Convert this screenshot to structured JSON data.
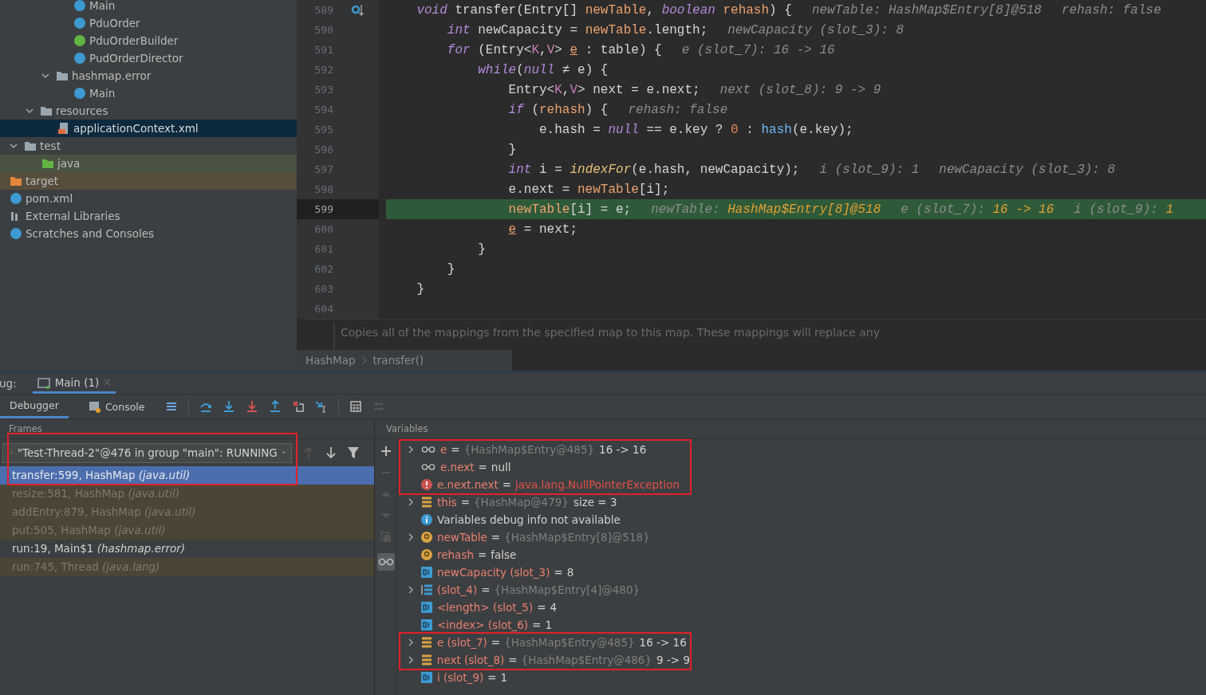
{
  "project_tree": [
    {
      "children": [
        {
          "children": [
            {
              "children": [
                {
                  "children": [
                    {
                      "label": "Main",
                      "kind": "class-run",
                      "selected": false
                    },
                    {
                      "label": "PduOrder",
                      "kind": "class",
                      "selected": false
                    },
                    {
                      "label": "PduOrderBuilder",
                      "kind": "interface",
                      "selected": false
                    },
                    {
                      "label": "PudOrderDirector",
                      "kind": "class",
                      "selected": false
                    }
                  ]
                },
                {
                  "label": "hashmap.error",
                  "kind": "package",
                  "expanded": true,
                  "selected": false,
                  "children": [
                    {
                      "label": "Main",
                      "kind": "class-run",
                      "selected": false
                    }
                  ]
                }
              ]
            },
            {
              "label": "resources",
              "kind": "resources",
              "expanded": true,
              "selected": false,
              "children": [
                {
                  "label": "applicationContext.xml",
                  "kind": "xml",
                  "selected": true
                }
              ]
            }
          ]
        },
        {
          "label": "test",
          "kind": "folder",
          "expanded": true,
          "selected": false,
          "children": [
            {
              "label": "java",
              "kind": "test-folder",
              "selected": false,
              "color": "#4a5243"
            }
          ]
        }
      ]
    },
    {
      "label": "target",
      "kind": "excluded-folder",
      "selected": false,
      "color": "#564d3c"
    },
    {
      "label": "pom.xml",
      "kind": "maven",
      "selected": false
    },
    {
      "label": "External Libraries",
      "kind": "library",
      "selected": false
    },
    {
      "label": "Scratches and Consoles",
      "kind": "scratch",
      "selected": false
    }
  ],
  "editor": {
    "lines": [
      {
        "number": "589",
        "current": false,
        "marker": true,
        "tokens": [
          {
            "kind": "kw",
            "text": "void"
          },
          {
            "kind": "plain",
            "text": " transfer(Entry[] "
          },
          {
            "kind": "param",
            "text": "newTable"
          },
          {
            "kind": "plain",
            "text": ", "
          },
          {
            "kind": "kw",
            "text": "boolean"
          },
          {
            "kind": "param",
            "text": " rehash"
          },
          {
            "kind": "plain",
            "text": ") {"
          }
        ],
        "hints": [
          {
            "label": "newTable:",
            "value": "HashMap$Entry[8]@518"
          },
          {
            "label": "rehash:",
            "value": "false"
          }
        ],
        "children": [
          {
            "number": "590",
            "current": false,
            "marker": false,
            "tokens": [
              {
                "kind": "kw",
                "text": "int"
              },
              {
                "kind": "plain",
                "text": " newCapacity = "
              },
              {
                "kind": "param",
                "text": "newTable"
              },
              {
                "kind": "plain",
                "text": ".length;"
              }
            ],
            "hints": [
              {
                "label": "newCapacity (slot_3):",
                "value": "8"
              }
            ]
          },
          {
            "number": "591",
            "current": false,
            "marker": false,
            "tokens": [
              {
                "kind": "kw",
                "text": "for"
              },
              {
                "kind": "plain",
                "text": " (Entry<"
              },
              {
                "kind": "type",
                "text": "K"
              },
              {
                "kind": "plain",
                "text": ","
              },
              {
                "kind": "type",
                "text": "V"
              },
              {
                "kind": "plain",
                "text": "> "
              },
              {
                "kind": "var",
                "text": "e"
              },
              {
                "kind": "plain",
                "text": " : table) {"
              }
            ],
            "hints": [
              {
                "label": "e (slot_7):",
                "value": "16 -> 16"
              }
            ],
            "children": [
              {
                "number": "592",
                "current": false,
                "marker": false,
                "tokens": [
                  {
                    "kind": "kw",
                    "text": "while"
                  },
                  {
                    "kind": "plain",
                    "text": "("
                  },
                  {
                    "kind": "kw",
                    "text": "null"
                  },
                  {
                    "kind": "plain",
                    "text": " ≠ e) {"
                  }
                ],
                "children": [
                  {
                    "number": "593",
                    "current": false,
                    "marker": false,
                    "tokens": [
                      {
                        "kind": "plain",
                        "text": "Entry<"
                      },
                      {
                        "kind": "type",
                        "text": "K"
                      },
                      {
                        "kind": "plain",
                        "text": ","
                      },
                      {
                        "kind": "type",
                        "text": "V"
                      },
                      {
                        "kind": "plain",
                        "text": "> next = e.next;"
                      }
                    ],
                    "hints": [
                      {
                        "label": "next (slot_8):",
                        "value": "9 -> 9"
                      }
                    ]
                  },
                  {
                    "number": "594",
                    "current": false,
                    "marker": false,
                    "tokens": [
                      {
                        "kind": "kw",
                        "text": "if"
                      },
                      {
                        "kind": "plain",
                        "text": " ("
                      },
                      {
                        "kind": "param",
                        "text": "rehash"
                      },
                      {
                        "kind": "plain",
                        "text": ") {"
                      }
                    ],
                    "hints": [
                      {
                        "label": "rehash:",
                        "value": "false"
                      }
                    ],
                    "children": [
                      {
                        "number": "595",
                        "current": false,
                        "marker": false,
                        "tokens": [
                          {
                            "kind": "plain",
                            "text": "e.hash = "
                          },
                          {
                            "kind": "kw",
                            "text": "null"
                          },
                          {
                            "kind": "plain",
                            "text": " == e.key ? "
                          },
                          {
                            "kind": "num",
                            "text": "0"
                          },
                          {
                            "kind": "plain",
                            "text": " : "
                          },
                          {
                            "kind": "call",
                            "text": "hash"
                          },
                          {
                            "kind": "plain",
                            "text": "(e.key);"
                          }
                        ]
                      }
                    ]
                  },
                  {
                    "number": "596",
                    "current": false,
                    "marker": false,
                    "tokens": [
                      {
                        "kind": "plain",
                        "text": "}"
                      }
                    ]
                  },
                  {
                    "number": "597",
                    "current": false,
                    "marker": false,
                    "tokens": [
                      {
                        "kind": "kw",
                        "text": "int"
                      },
                      {
                        "kind": "plain",
                        "text": " i = "
                      },
                      {
                        "kind": "static",
                        "text": "indexFor"
                      },
                      {
                        "kind": "plain",
                        "text": "(e.hash, newCapacity);"
                      }
                    ],
                    "hints": [
                      {
                        "label": "i (slot_9):",
                        "value": "1"
                      },
                      {
                        "label": "newCapacity (slot_3):",
                        "value": "8"
                      }
                    ]
                  },
                  {
                    "number": "598",
                    "current": false,
                    "marker": false,
                    "tokens": [
                      {
                        "kind": "plain",
                        "text": "e.next = "
                      },
                      {
                        "kind": "param",
                        "text": "newTable"
                      },
                      {
                        "kind": "plain",
                        "text": "[i];"
                      }
                    ]
                  },
                  {
                    "number": "599",
                    "current": true,
                    "marker": false,
                    "tokens": [
                      {
                        "kind": "param",
                        "text": "newTable"
                      },
                      {
                        "kind": "plain",
                        "text": "[i] = e;"
                      }
                    ],
                    "hints": [
                      {
                        "label": "newTable:",
                        "value": "HashMap$Entry[8]@518"
                      },
                      {
                        "label": "e (slot_7):",
                        "value": "16 -> 16"
                      },
                      {
                        "label": "i (slot_9):",
                        "value": "1"
                      }
                    ]
                  },
                  {
                    "number": "600",
                    "current": false,
                    "marker": false,
                    "tokens": [
                      {
                        "kind": "var",
                        "text": "e"
                      },
                      {
                        "kind": "plain",
                        "text": " = next;"
                      }
                    ]
                  }
                ]
              },
              {
                "number": "601",
                "current": false,
                "marker": false,
                "tokens": [
                  {
                    "kind": "plain",
                    "text": "}"
                  }
                ]
              }
            ]
          },
          {
            "number": "602",
            "current": false,
            "marker": false,
            "tokens": [
              {
                "kind": "plain",
                "text": "}"
              }
            ]
          }
        ]
      },
      {
        "number": "603",
        "current": false,
        "marker": false,
        "tokens": [
          {
            "kind": "plain",
            "text": "}"
          }
        ]
      },
      {
        "number": "604",
        "current": false,
        "marker": false
      }
    ],
    "doc_comment": "Copies all of the mappings from the specified map to this map. These mappings will replace any",
    "breadcrumbs": [
      "HashMap",
      "transfer()"
    ]
  },
  "debug_window": {
    "title": "ug:",
    "tabs": [
      {
        "label": "Main (1)",
        "selected": true
      }
    ],
    "view_tabs": [
      {
        "label": "Debugger",
        "selected": true
      },
      {
        "label": "Console",
        "selected": false
      }
    ]
  },
  "frames_panel": {
    "title": "Frames",
    "thread": "\"Test-Thread-2\"@476 in group \"main\": RUNNING",
    "highlighted": true,
    "frames": [
      {
        "method": "transfer:599, HashMap",
        "package": "(java.util)",
        "kind": "library",
        "selected": true
      },
      {
        "method": "resize:581, HashMap",
        "package": "(java.util)",
        "kind": "library",
        "selected": false
      },
      {
        "method": "addEntry:879, HashMap",
        "package": "(java.util)",
        "kind": "library",
        "selected": false
      },
      {
        "method": "put:505, HashMap",
        "package": "(java.util)",
        "kind": "library",
        "selected": false
      },
      {
        "method": "run:19, Main$1",
        "package": "(hashmap.error)",
        "kind": "user",
        "selected": false
      },
      {
        "method": "run:745, Thread",
        "package": "(java.lang)",
        "kind": "library",
        "selected": false
      }
    ]
  },
  "variables_panel": {
    "title": "Variables",
    "groups": [
      {
        "highlighted": true,
        "items": [
          {
            "kind": "watch",
            "expanded": false,
            "name": "e",
            "separator": "=",
            "ref": "{HashMap$Entry@485}",
            "value": "16 -> 16"
          },
          {
            "kind": "watch",
            "name": "e.next",
            "separator": "=",
            "value": "null"
          },
          {
            "kind": "error",
            "name": "e.next.next",
            "separator": "=",
            "value": "java.lang.NullPointerException"
          }
        ]
      },
      {
        "highlighted": false,
        "items": [
          {
            "kind": "object",
            "expanded": false,
            "name": "this",
            "separator": "=",
            "ref": "{HashMap@479}",
            "value": "size = 3"
          },
          {
            "kind": "info",
            "name": "Variables debug info not available"
          },
          {
            "kind": "param",
            "expanded": false,
            "name": "newTable",
            "separator": "=",
            "ref": "{HashMap$Entry[8]@518}"
          },
          {
            "kind": "param",
            "name": "rehash",
            "separator": "=",
            "value": "false"
          },
          {
            "kind": "primitive",
            "name": "newCapacity (slot_3)",
            "separator": "=",
            "value": "8"
          },
          {
            "kind": "array",
            "expanded": false,
            "name": "(slot_4)",
            "separator": "=",
            "ref": "{HashMap$Entry[4]@480}"
          },
          {
            "kind": "primitive",
            "name": "<length> (slot_5)",
            "separator": "=",
            "value": "4"
          },
          {
            "kind": "primitive",
            "name": "<index> (slot_6)",
            "separator": "=",
            "value": "1"
          }
        ]
      },
      {
        "highlighted": true,
        "items": [
          {
            "kind": "object",
            "expanded": false,
            "name": "e (slot_7)",
            "separator": "=",
            "ref": "{HashMap$Entry@485}",
            "value": "16 -> 16"
          },
          {
            "kind": "object",
            "expanded": false,
            "name": "next (slot_8)",
            "separator": "=",
            "ref": "{HashMap$Entry@486}",
            "value": "9 -> 9"
          }
        ]
      },
      {
        "highlighted": false,
        "items": [
          {
            "kind": "primitive",
            "name": "i (slot_9)",
            "separator": "=",
            "value": "1"
          }
        ]
      }
    ]
  }
}
